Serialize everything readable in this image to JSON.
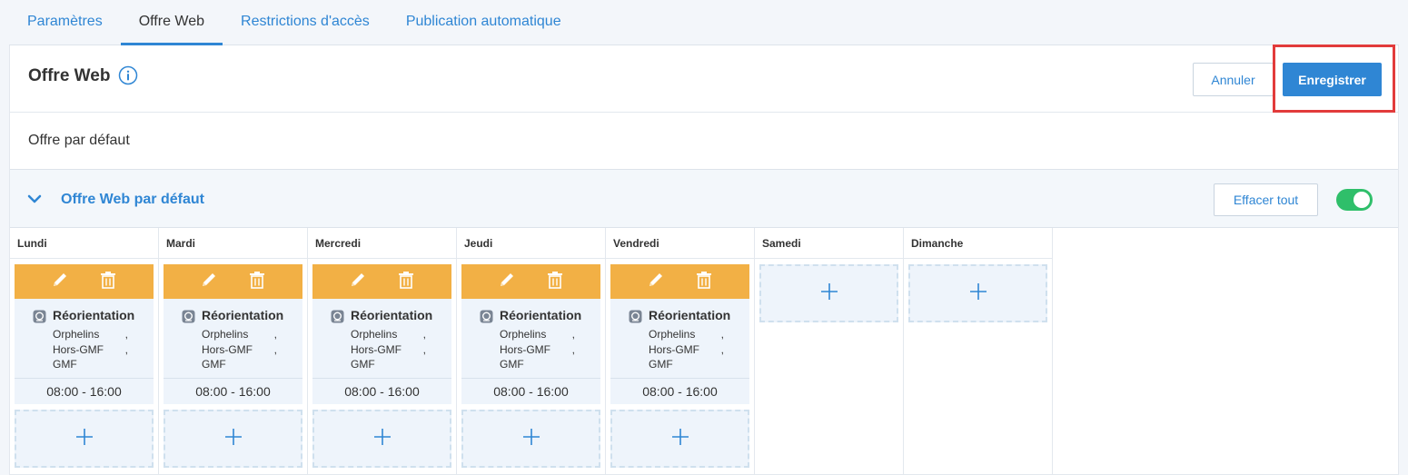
{
  "tabs": [
    {
      "label": "Paramètres",
      "active": false
    },
    {
      "label": "Offre Web",
      "active": true
    },
    {
      "label": "Restrictions d'accès",
      "active": false
    },
    {
      "label": "Publication automatique",
      "active": false
    }
  ],
  "header": {
    "title": "Offre Web",
    "info_icon": "info-circle-icon",
    "cancel_label": "Annuler",
    "save_label": "Enregistrer",
    "save_highlight_color": "#e23b3b"
  },
  "default_offer": {
    "label": "Offre par défaut"
  },
  "section": {
    "title": "Offre Web par défaut",
    "expanded": true,
    "clear_label": "Effacer tout",
    "toggle_on": true
  },
  "days": [
    {
      "name": "Lundi",
      "slot": {
        "type": "Réorientation",
        "lines": [
          [
            "Orphelins",
            ","
          ],
          [
            "Hors-GMF",
            ","
          ],
          [
            "GMF",
            ""
          ]
        ],
        "time": "08:00 - 16:00"
      }
    },
    {
      "name": "Mardi",
      "slot": {
        "type": "Réorientation",
        "lines": [
          [
            "Orphelins",
            ","
          ],
          [
            "Hors-GMF",
            ","
          ],
          [
            "GMF",
            ""
          ]
        ],
        "time": "08:00 - 16:00"
      }
    },
    {
      "name": "Mercredi",
      "slot": {
        "type": "Réorientation",
        "lines": [
          [
            "Orphelins",
            ","
          ],
          [
            "Hors-GMF",
            ","
          ],
          [
            "GMF",
            ""
          ]
        ],
        "time": "08:00 - 16:00"
      }
    },
    {
      "name": "Jeudi",
      "slot": {
        "type": "Réorientation",
        "lines": [
          [
            "Orphelins",
            ","
          ],
          [
            "Hors-GMF",
            ","
          ],
          [
            "GMF",
            ""
          ]
        ],
        "time": "08:00 - 16:00"
      }
    },
    {
      "name": "Vendredi",
      "slot": {
        "type": "Réorientation",
        "lines": [
          [
            "Orphelins",
            ","
          ],
          [
            "Hors-GMF",
            ","
          ],
          [
            "GMF",
            ""
          ]
        ],
        "time": "08:00 - 16:00"
      }
    },
    {
      "name": "Samedi",
      "slot": null
    },
    {
      "name": "Dimanche",
      "slot": null
    }
  ],
  "colors": {
    "accent": "#2f86d4",
    "card_bar": "#f2b045",
    "toggle": "#2fbf6a"
  }
}
